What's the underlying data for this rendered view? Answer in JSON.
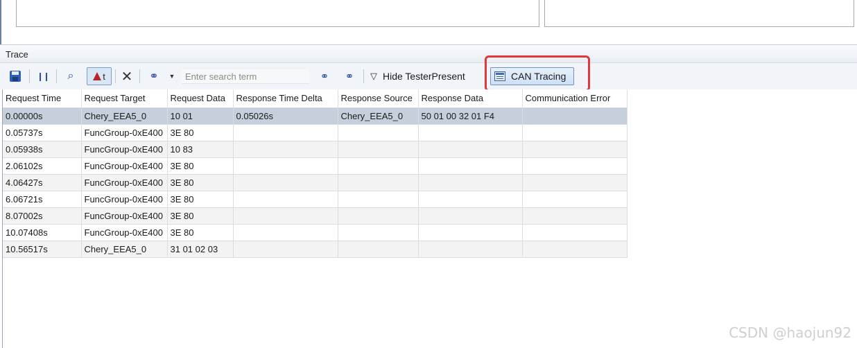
{
  "panel": {
    "title": "Trace"
  },
  "toolbar": {
    "search_placeholder": "Enter search term",
    "filter_label": "Hide TesterPresent",
    "can_label": "CAN Tracing",
    "at_label": "t"
  },
  "table": {
    "columns": [
      "Request Time",
      "Request Target",
      "Request Data",
      "Response Time Delta",
      "Response Source",
      "Response Data",
      "Communication Error"
    ],
    "rows": [
      [
        "0.00000s",
        "Chery_EEA5_0",
        "10 01",
        "0.05026s",
        "Chery_EEA5_0",
        "50 01 00 32 01 F4",
        ""
      ],
      [
        "0.05737s",
        "FuncGroup-0xE400",
        "3E 80",
        "",
        "",
        "",
        ""
      ],
      [
        "0.05938s",
        "FuncGroup-0xE400",
        "10 83",
        "",
        "",
        "",
        ""
      ],
      [
        "2.06102s",
        "FuncGroup-0xE400",
        "3E 80",
        "",
        "",
        "",
        ""
      ],
      [
        "4.06427s",
        "FuncGroup-0xE400",
        "3E 80",
        "",
        "",
        "",
        ""
      ],
      [
        "6.06721s",
        "FuncGroup-0xE400",
        "3E 80",
        "",
        "",
        "",
        ""
      ],
      [
        "8.07002s",
        "FuncGroup-0xE400",
        "3E 80",
        "",
        "",
        "",
        ""
      ],
      [
        "10.07408s",
        "FuncGroup-0xE400",
        "3E 80",
        "",
        "",
        "",
        ""
      ],
      [
        "10.56517s",
        "Chery_EEA5_0",
        "31 01 02 03",
        "",
        "",
        "",
        ""
      ]
    ]
  },
  "watermark": "CSDN @haojun92",
  "colors": {
    "selected_row": "#c5d0dc",
    "highlight_box": "#e0393a"
  }
}
